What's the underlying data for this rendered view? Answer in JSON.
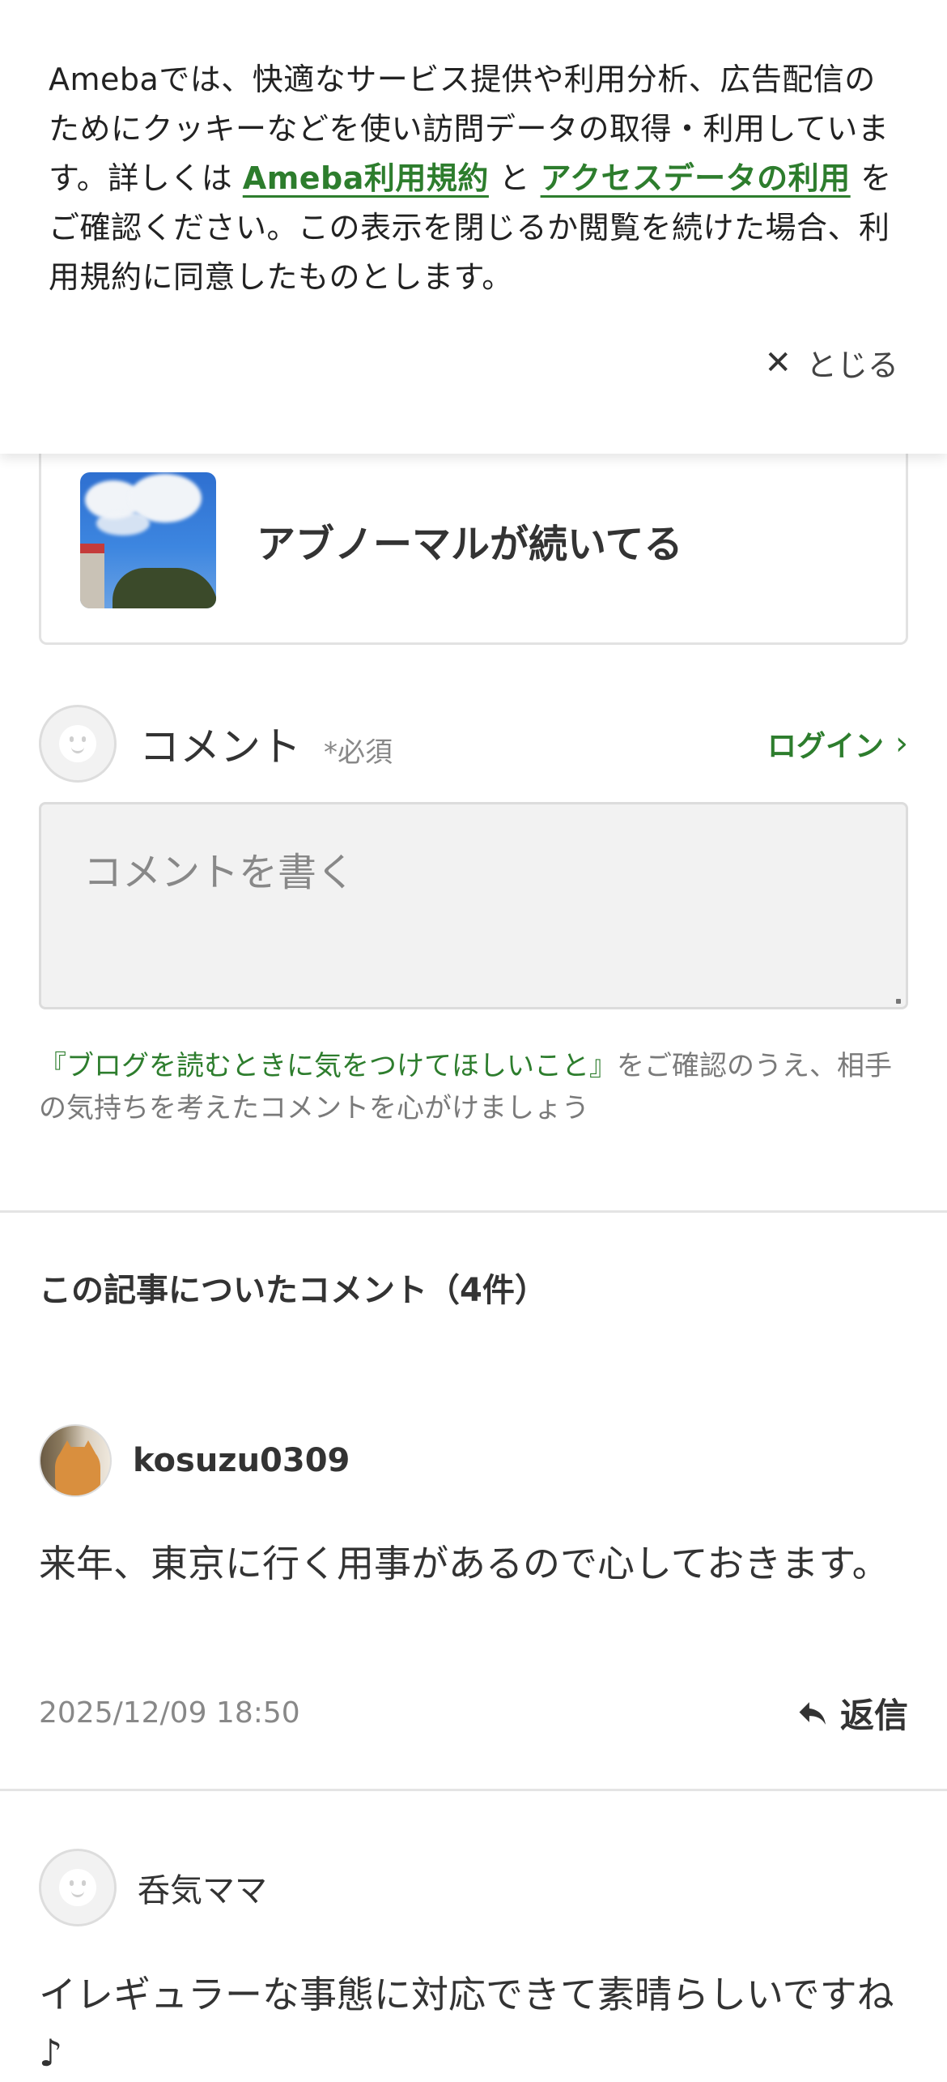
{
  "cookie_banner": {
    "text_before": "Amebaでは、快適なサービス提供や利用分析、広告配信のためにクッキーなどを使い訪問データの取得・利用しています。詳しくは ",
    "link_terms": "Ameba利用規約",
    "text_and": " と ",
    "link_access": "アクセスデータの利用",
    "text_after": " をご確認ください。この表示を閉じるか閲覧を続けた場合、利用規約に同意したものとします。",
    "close_label": "とじる"
  },
  "article_card": {
    "title": "アブノーマルが続いてる"
  },
  "comment_form": {
    "label": "コメント",
    "required": "*必須",
    "login_label": "ログイン",
    "placeholder": "コメントを書く",
    "guideline_link": "『ブログを読むときに気をつけてほしいこと』",
    "guideline_text": "をご確認のうえ、相手の気持ちを考えたコメントを心がけましょう"
  },
  "comments_section": {
    "heading": "この記事についたコメント（4件）",
    "comments": [
      {
        "author": "kosuzu0309",
        "body": "来年、東京に行く用事があるので心しておきます。",
        "date": "2025/12/09 18:50",
        "reply_label": "返信"
      },
      {
        "author": "呑気ママ",
        "body": "イレギュラーな事態に対応できて素晴らしいですね♪"
      }
    ]
  }
}
